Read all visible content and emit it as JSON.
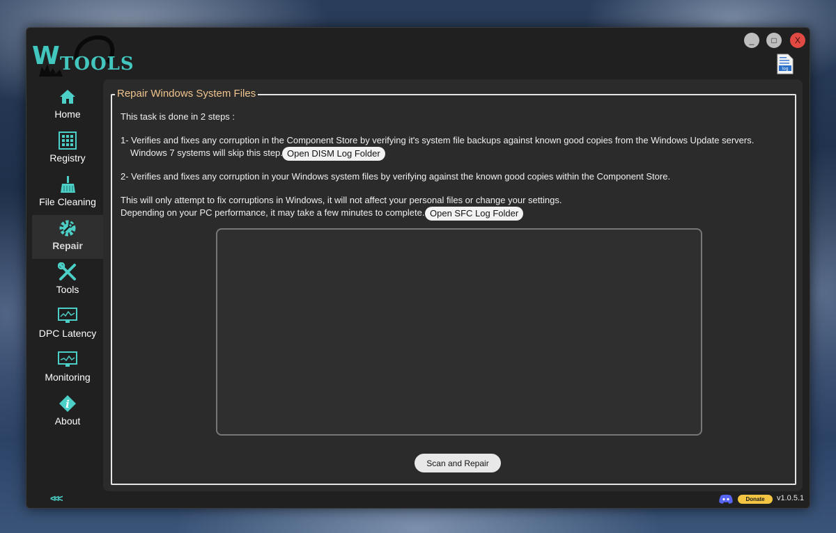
{
  "app": {
    "logo_text": "TOOLS",
    "logo_letter": "W"
  },
  "window_controls": {
    "minimize": "_",
    "maximize": "□",
    "close": "X"
  },
  "header": {
    "log_icon_label": "log"
  },
  "sidebar": {
    "items": [
      {
        "label": "Home",
        "icon": "home-icon"
      },
      {
        "label": "Registry",
        "icon": "registry-icon"
      },
      {
        "label": "File Cleaning",
        "icon": "broom-icon"
      },
      {
        "label": "Repair",
        "icon": "gear-icon",
        "active": true
      },
      {
        "label": "Tools",
        "icon": "tools-icon"
      },
      {
        "label": "DPC Latency",
        "icon": "monitor-icon"
      },
      {
        "label": "Monitoring",
        "icon": "monitor-icon"
      },
      {
        "label": "About",
        "icon": "info-icon"
      }
    ],
    "collapse_label": "<<<"
  },
  "main": {
    "group_title": "Repair Windows System Files",
    "intro": "This task is done in 2 steps :",
    "step1_line1": "1- Verifies and fixes any corruption in the Component Store by verifying it's system file backups against known good copies from the Windows Update servers.",
    "step1_line2": "Windows 7 systems will skip this step.",
    "dism_button": "Open DISM Log Folder",
    "step2": "2- Verifies and fixes any corruption in your Windows system files by verifying against the known good copies within the Component Store.",
    "note1": "This will only attempt to fix corruptions in Windows, it will not affect your personal files or change your settings.",
    "note2": "Depending on your PC performance, it may take a few minutes to complete.",
    "sfc_button": "Open SFC Log Folder",
    "output": "",
    "scan_button": "Scan and Repair"
  },
  "footer": {
    "donate_label": "Donate",
    "version": "v1.0.5.1"
  },
  "colors": {
    "accent": "#43c6bd",
    "title": "#f1c48e",
    "donate": "#f4c542",
    "close": "#e04a43"
  }
}
